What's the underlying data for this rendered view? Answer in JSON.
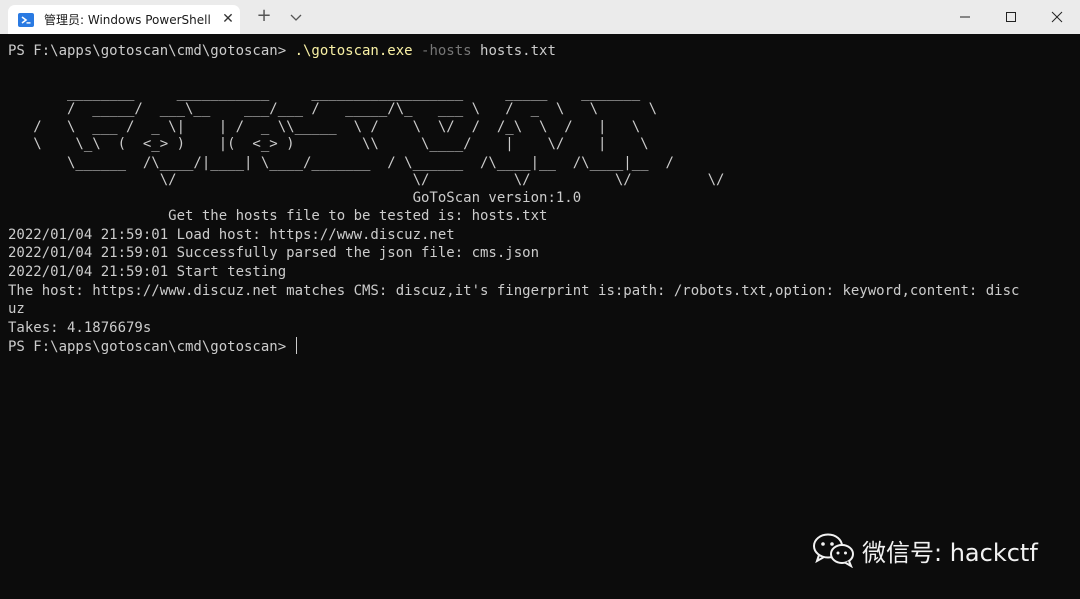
{
  "window": {
    "tab_title": "管理员: Windows PowerShell",
    "tab_close_glyph": "✕",
    "new_tab_glyph": "+"
  },
  "colors": {
    "titlebar_bg": "#ebebeb",
    "terminal_bg": "#0c0c0c",
    "text": "#cccccc",
    "command_exe": "#f9f1a5",
    "command_flag": "#767676",
    "powershell_icon": "#2a7ae2"
  },
  "icons": {
    "tab_icon": "powershell-icon",
    "dropdown": "chevron-down-icon",
    "minimize": "minimize-icon",
    "maximize": "maximize-icon",
    "close": "close-icon",
    "watermark": "wechat-icon"
  },
  "terminal": {
    "command_prompt": "PS F:\\apps\\gotoscan\\cmd\\gotoscan> ",
    "command_exe": ".\\gotoscan.exe",
    "command_flag": " -hosts",
    "command_arg": " hosts.txt",
    "banner": [
      "       ________     ___________     __________________     _____    _______",
      "       /  _____/  ___\\__    ___/___ /   _____/\\_   ___ \\   /  _  \\   \\      \\",
      "   /   \\  ___ /  _ \\|    | /  _ \\\\_____  \\ /    \\  \\/  /  /_\\  \\  /   |   \\",
      "   \\    \\_\\  (  <_> )    |(  <_> )        \\\\     \\____/    |    \\/    |    \\",
      "       \\______  /\\____/|____| \\____/_______  / \\______  /\\____|__  /\\____|__  /",
      "                  \\/                            \\/          \\/          \\/         \\/"
    ],
    "version_line": "                                                GoToScan version:1.0",
    "output": [
      "                   Get the hosts file to be tested is: hosts.txt",
      "2022/01/04 21:59:01 Load host: https://www.discuz.net",
      "2022/01/04 21:59:01 Successfully parsed the json file: cms.json",
      "2022/01/04 21:59:01 Start testing",
      "The host: https://www.discuz.net matches CMS: discuz,it's fingerprint is:path: /robots.txt,option: keyword,content: disc",
      "uz",
      "Takes: 4.1876679s"
    ],
    "final_prompt": "PS F:\\apps\\gotoscan\\cmd\\gotoscan> "
  },
  "watermark": {
    "text": "微信号: hackctf"
  }
}
